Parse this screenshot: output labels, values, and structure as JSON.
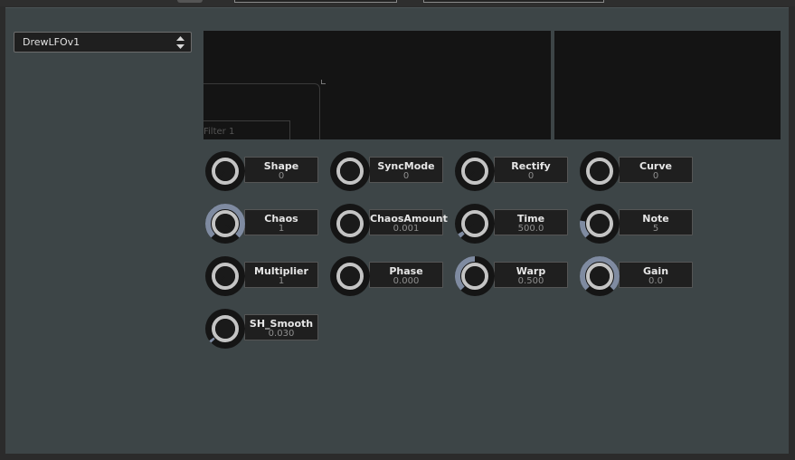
{
  "plugin": {
    "preset": {
      "selected": "DrewLFOv1"
    },
    "display": {
      "marker_label": "L",
      "filter_label": "Filter 1"
    },
    "params": [
      {
        "name": "Shape",
        "value": "0",
        "knob_level": 0.0,
        "knob_icon": "knob-icon"
      },
      {
        "name": "SyncMode",
        "value": "0",
        "knob_level": 0.0,
        "knob_icon": "knob-icon"
      },
      {
        "name": "Rectify",
        "value": "0",
        "knob_level": 0.0,
        "knob_icon": "knob-icon"
      },
      {
        "name": "Curve",
        "value": "0",
        "knob_level": 0.0,
        "knob_icon": "knob-icon"
      },
      {
        "name": "Chaos",
        "value": "1",
        "knob_level": 1.0,
        "knob_icon": "knob-icon"
      },
      {
        "name": "ChaosAmount",
        "value": "0.001",
        "knob_level": 0.0,
        "knob_icon": "knob-icon"
      },
      {
        "name": "Time",
        "value": "500.0",
        "knob_level": 0.05,
        "knob_icon": "knob-icon"
      },
      {
        "name": "Note",
        "value": "5",
        "knob_level": 0.2,
        "knob_icon": "knob-icon"
      },
      {
        "name": "Multiplier",
        "value": "1",
        "knob_level": 0.0,
        "knob_icon": "knob-icon"
      },
      {
        "name": "Phase",
        "value": "0.000",
        "knob_level": 0.0,
        "knob_icon": "knob-icon"
      },
      {
        "name": "Warp",
        "value": "0.500",
        "knob_level": 0.5,
        "knob_icon": "knob-icon"
      },
      {
        "name": "Gain",
        "value": "0.0",
        "knob_level": 1.0,
        "knob_icon": "knob-icon"
      },
      {
        "name": "SH_Smooth",
        "value": "0.030",
        "knob_level": 0.03,
        "knob_icon": "knob-icon"
      }
    ]
  },
  "colors": {
    "panel": "#3d4547",
    "knob_track": "#151515",
    "knob_fill": "#7f8ba1",
    "knob_inner": "#c4c4c4",
    "display_bg": "#141414"
  }
}
